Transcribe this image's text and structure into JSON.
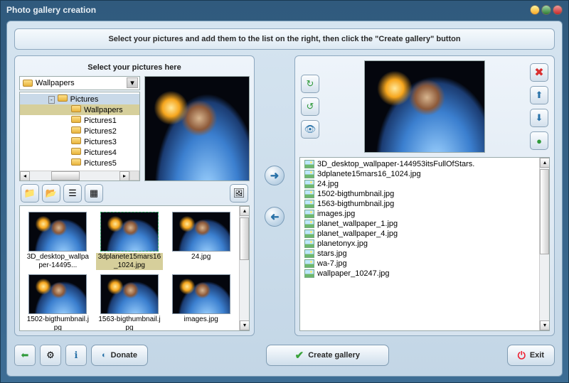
{
  "window": {
    "title": "Photo gallery creation"
  },
  "instruction": "Select your pictures and add them to the list on the right, then click the \"Create gallery\" button",
  "left": {
    "title": "Select your pictures here",
    "dropdown_folder": "Wallpapers",
    "tree": {
      "header": "Pictures",
      "items": [
        "Wallpapers",
        "Pictures1",
        "Pictures2",
        "Pictures3",
        "Pictures4",
        "Pictures5"
      ],
      "selected_index": 0
    },
    "thumbnails": [
      {
        "label": "3D_desktop_wallpaper-14495..."
      },
      {
        "label": "3dplanete15mars16_1024.jpg",
        "selected": true
      },
      {
        "label": "24.jpg"
      },
      {
        "label": "1502-bigthumbnail.jpg"
      },
      {
        "label": "1563-bigthumbnail.jpg"
      },
      {
        "label": "images.jpg"
      }
    ]
  },
  "right": {
    "files": [
      "3D_desktop_wallpaper-144953itsFullOfStars.",
      "3dplanete15mars16_1024.jpg",
      "24.jpg",
      "1502-bigthumbnail.jpg",
      "1563-bigthumbnail.jpg",
      "images.jpg",
      "planet_wallpaper_1.jpg",
      "planet_wallpaper_4.jpg",
      "planetonyx.jpg",
      "stars.jpg",
      "wa-7.jpg",
      "wallpaper_10247.jpg"
    ]
  },
  "footer": {
    "donate": "Donate",
    "create": "Create gallery",
    "exit": "Exit"
  }
}
